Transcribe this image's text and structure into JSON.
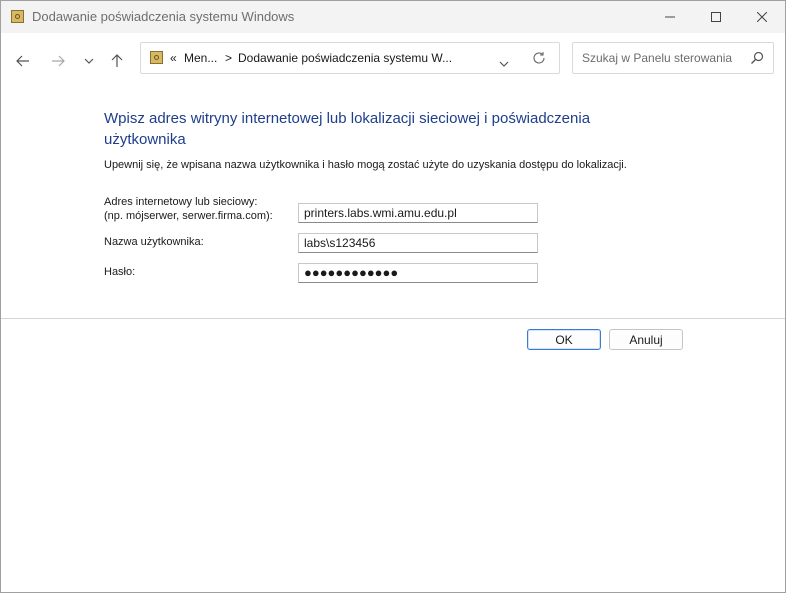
{
  "window": {
    "title": "Dodawanie poświadczenia systemu Windows"
  },
  "address_bar": {
    "chevrons": "«",
    "crumb1": "Men...",
    "separator": ">",
    "crumb2": "Dodawanie poświadczenia systemu W..."
  },
  "search": {
    "placeholder": "Szukaj w Panelu sterowania"
  },
  "form": {
    "heading": "Wpisz adres witryny internetowej lub lokalizacji sieciowej i poświadczenia użytkownika",
    "description": "Upewnij się, że wpisana nazwa użytkownika i hasło mogą zostać użyte do uzyskania dostępu do lokalizacji.",
    "address_label_line1": "Adres internetowy lub sieciowy:",
    "address_label_line2": "(np. mójserwer, serwer.firma.com):",
    "address_value": "printers.labs.wmi.amu.edu.pl",
    "username_label": "Nazwa użytkownika:",
    "username_value": "labs\\s123456",
    "password_label": "Hasło:",
    "password_value": "●●●●●●●●●●●●"
  },
  "buttons": {
    "ok": "OK",
    "cancel": "Anuluj"
  }
}
